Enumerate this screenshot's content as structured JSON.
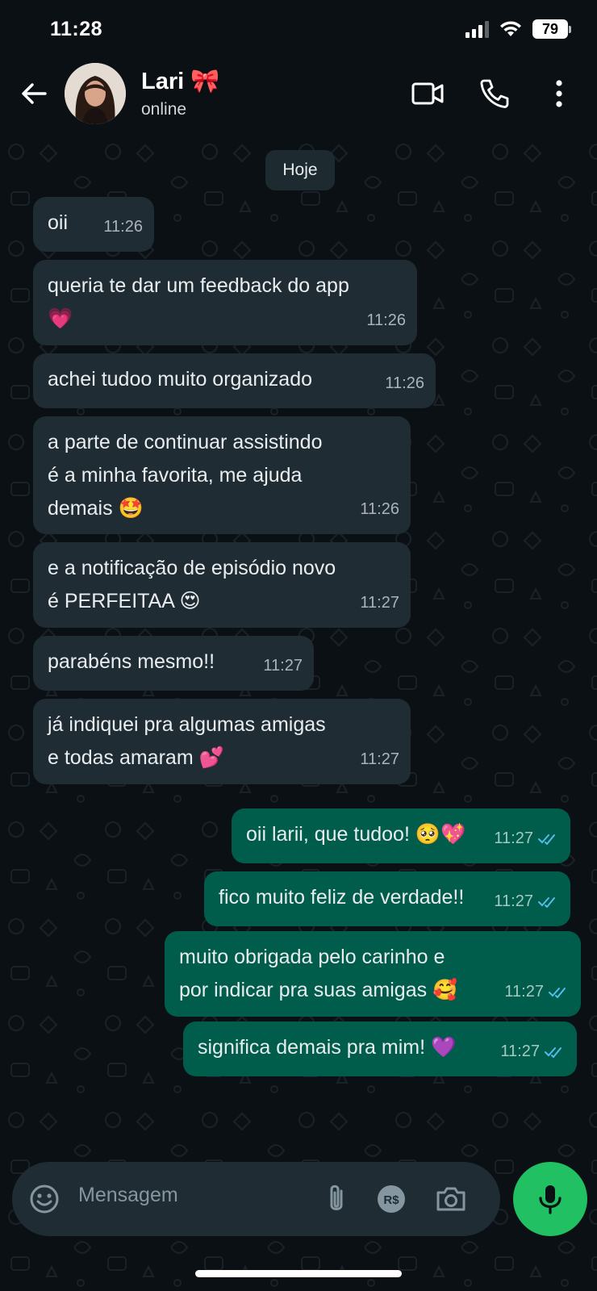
{
  "status_bar": {
    "time": "11:28",
    "battery": "79"
  },
  "header": {
    "contact_name": "Lari 🎀",
    "contact_status": "online"
  },
  "chat": {
    "date_label": "Hoje",
    "messages": [
      {
        "dir": "in",
        "text": "oii",
        "time": "11:26"
      },
      {
        "dir": "in",
        "text": "queria te dar um feedback do app\n💗",
        "time": "11:26"
      },
      {
        "dir": "in",
        "text": "achei tudoo muito organizado",
        "time": "11:26"
      },
      {
        "dir": "in",
        "text": "a parte de continuar assistindo\né a minha favorita, me ajuda\ndemais 🤩",
        "time": "11:26"
      },
      {
        "dir": "in",
        "text": "e a notificação de episódio novo\né PERFEITAA 😍",
        "time": "11:27"
      },
      {
        "dir": "in",
        "text": "parabéns mesmo!!",
        "time": "11:27"
      },
      {
        "dir": "in",
        "text": "já indiquei pra algumas amigas\ne todas amaram 💕",
        "time": "11:27"
      },
      {
        "dir": "out",
        "text": "oii larii, que tudoo! 🥺💖",
        "time": "11:27",
        "status": "read"
      },
      {
        "dir": "out",
        "text": "fico muito feliz de verdade!!",
        "time": "11:27",
        "status": "read"
      },
      {
        "dir": "out",
        "text": "muito obrigada pelo carinho e\npor indicar pra suas amigas 🥰",
        "time": "11:27",
        "status": "read"
      },
      {
        "dir": "out",
        "text": "significa demais pra mim! 💜",
        "time": "11:27",
        "status": "read"
      }
    ]
  },
  "input": {
    "placeholder": "Mensagem"
  },
  "icons": {
    "back": "arrow-left-icon",
    "video": "video-call-icon",
    "call": "phone-icon",
    "menu": "more-vertical-icon",
    "emoji": "emoji-icon",
    "attach": "paperclip-icon",
    "payment": "payment-brl-icon",
    "camera": "camera-icon",
    "mic": "microphone-icon",
    "read": "double-check-icon"
  },
  "colors": {
    "background": "#0b1014",
    "incoming_bubble": "#1f2c33",
    "outgoing_bubble": "#005c4b",
    "read_tick": "#53bdeb",
    "mic_button": "#21c063"
  }
}
